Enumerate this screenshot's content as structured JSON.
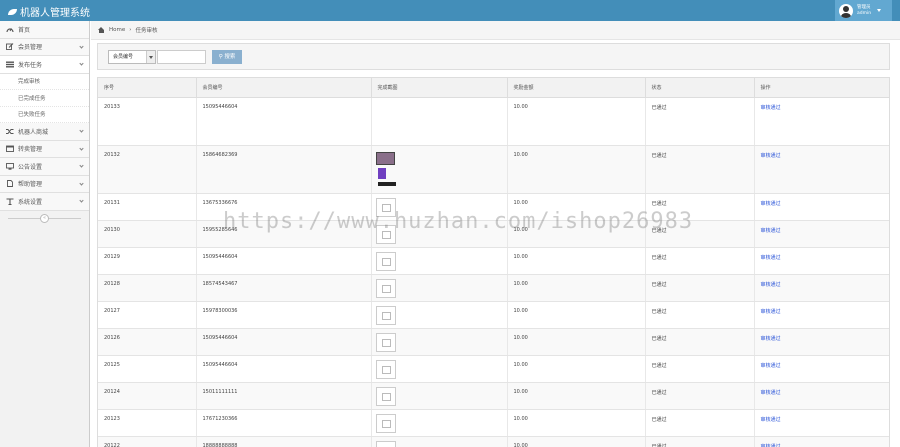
{
  "app": {
    "title": "机器人管理系统"
  },
  "user": {
    "role": "管理员",
    "name": "admin"
  },
  "sidebar": {
    "items": [
      {
        "label": "首页",
        "icon": "dashboard-icon"
      },
      {
        "label": "会员管理",
        "icon": "edit-icon"
      },
      {
        "label": "发布任务",
        "icon": "list-icon",
        "subitems": [
          "完成审核",
          "已完成任务",
          "已失败任务"
        ]
      },
      {
        "label": "机器人商城",
        "icon": "shuffle-icon"
      },
      {
        "label": "转卖管理",
        "icon": "calendar-icon"
      },
      {
        "label": "公告设置",
        "icon": "desktop-icon"
      },
      {
        "label": "帮助管理",
        "icon": "file-icon"
      },
      {
        "label": "系统设置",
        "icon": "text-icon"
      }
    ],
    "collapse_glyph": "«"
  },
  "breadcrumb": {
    "home": "Home",
    "current": "任务审核"
  },
  "search": {
    "select_value": "会员编号",
    "button_label": "搜索"
  },
  "table": {
    "columns": [
      "序号",
      "会员编号",
      "完成截图",
      "奖励金额",
      "状态",
      "操作"
    ],
    "rows": [
      {
        "id": "20133",
        "member": "15095446604",
        "img": "none",
        "amount": "10.00",
        "status": "已通过",
        "action": "审核通过"
      },
      {
        "id": "20132",
        "member": "15864682369",
        "img": "stack",
        "amount": "10.00",
        "status": "已通过",
        "action": "审核通过"
      },
      {
        "id": "20131",
        "member": "13675336676",
        "img": "thumb",
        "amount": "10.00",
        "status": "已通过",
        "action": "审核通过"
      },
      {
        "id": "20130",
        "member": "15955285646",
        "img": "thumb",
        "amount": "10.00",
        "status": "已通过",
        "action": "审核通过"
      },
      {
        "id": "20129",
        "member": "15095446604",
        "img": "thumb",
        "amount": "10.00",
        "status": "已通过",
        "action": "审核通过"
      },
      {
        "id": "20128",
        "member": "18574543467",
        "img": "thumb",
        "amount": "10.00",
        "status": "已通过",
        "action": "审核通过"
      },
      {
        "id": "20127",
        "member": "15978300036",
        "img": "thumb",
        "amount": "10.00",
        "status": "已通过",
        "action": "审核通过"
      },
      {
        "id": "20126",
        "member": "15095446604",
        "img": "thumb",
        "amount": "10.00",
        "status": "已通过",
        "action": "审核通过"
      },
      {
        "id": "20125",
        "member": "15095446604",
        "img": "thumb",
        "amount": "10.00",
        "status": "已通过",
        "action": "审核通过"
      },
      {
        "id": "20124",
        "member": "15011111111",
        "img": "thumb",
        "amount": "10.00",
        "status": "已通过",
        "action": "审核通过"
      },
      {
        "id": "20123",
        "member": "17671230366",
        "img": "thumb",
        "amount": "10.00",
        "status": "已通过",
        "action": "审核通过"
      },
      {
        "id": "20122",
        "member": "18888888888",
        "img": "thumb",
        "amount": "10.00",
        "status": "已通过",
        "action": "审核通过"
      }
    ]
  },
  "watermark": "https://www.huzhan.com/ishop26983"
}
